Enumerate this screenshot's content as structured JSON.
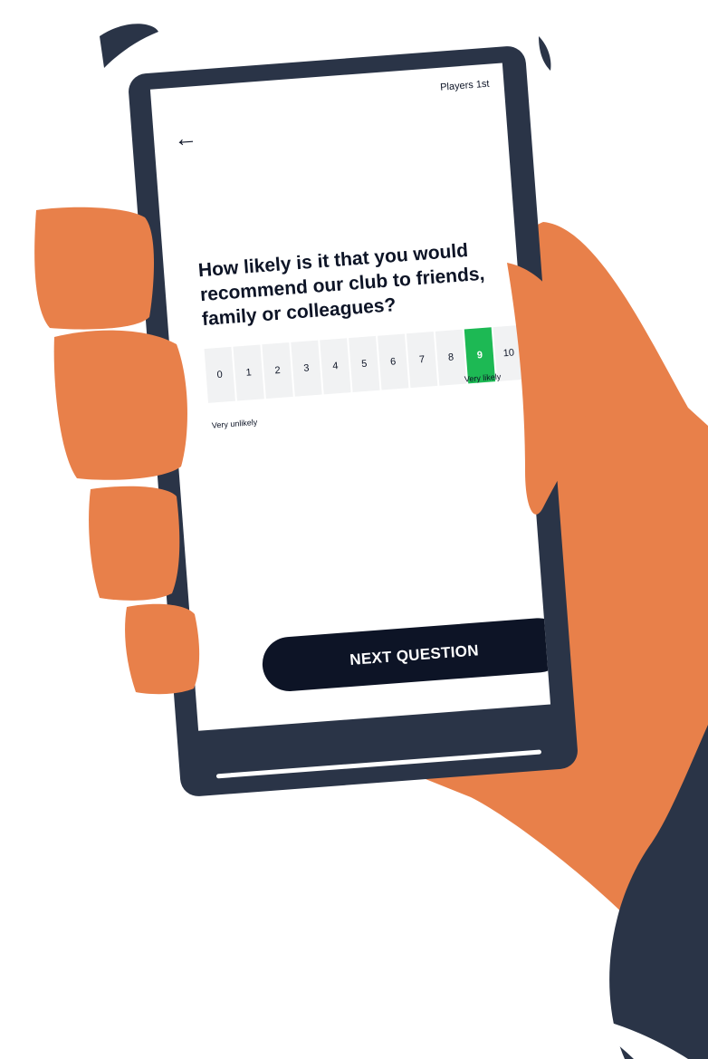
{
  "header": {
    "brand": "Players 1st"
  },
  "survey": {
    "question": "How likely is it that you would recommend our club to friends, family or colleagues?",
    "scale": [
      "0",
      "1",
      "2",
      "3",
      "4",
      "5",
      "6",
      "7",
      "8",
      "9",
      "10"
    ],
    "selected_value": "9",
    "label_low": "Very unlikely",
    "label_high": "Very likely"
  },
  "footer": {
    "next_label": "NEXT QUESTION"
  },
  "colors": {
    "hand": "#e8804a",
    "phone": "#2a3447",
    "selected": "#1db954",
    "button": "#0d1426"
  },
  "icons": {
    "back": "arrow-left-icon"
  }
}
